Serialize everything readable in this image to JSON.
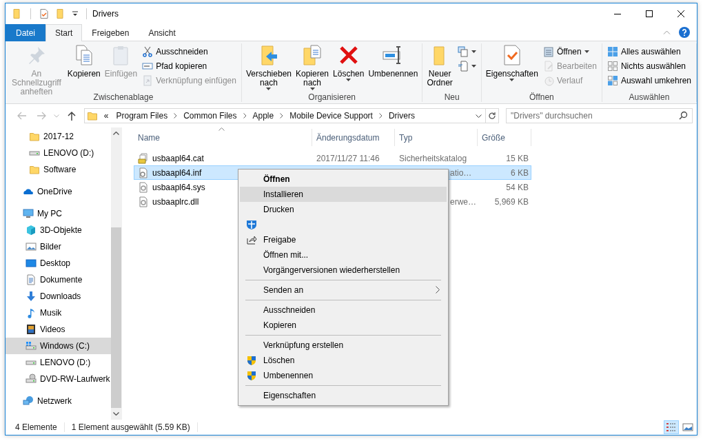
{
  "window": {
    "title": "Drivers"
  },
  "ribbon_tabs": [
    {
      "label": "Datei",
      "kind": "file",
      "selected": false
    },
    {
      "label": "Start",
      "kind": "tab",
      "selected": true
    },
    {
      "label": "Freigeben",
      "kind": "tab",
      "selected": false
    },
    {
      "label": "Ansicht",
      "kind": "tab",
      "selected": false
    }
  ],
  "ribbon_groups": [
    {
      "label": "Zwischenablage",
      "items": [
        {
          "kind": "pin",
          "label": "An Schnellzugriff\nanheften",
          "disabled": true,
          "dropdown": false
        },
        {
          "kind": "copy",
          "label": "Kopieren",
          "disabled": false,
          "dropdown": false
        },
        {
          "kind": "paste",
          "label": "Einfügen",
          "disabled": true,
          "dropdown": false
        },
        {
          "kind": "stack",
          "items": [
            {
              "kind": "cut",
              "label": "Ausschneiden",
              "disabled": false,
              "dropdown": false
            },
            {
              "kind": "copy-path",
              "label": "Pfad kopieren",
              "disabled": false,
              "dropdown": false
            },
            {
              "kind": "paste-shortcut",
              "label": "Verknüpfung einfügen",
              "disabled": true,
              "dropdown": false
            }
          ]
        }
      ]
    },
    {
      "label": "Organisieren",
      "items": [
        {
          "kind": "move-to",
          "label": "Verschieben\nnach",
          "disabled": false,
          "dropdown": true
        },
        {
          "kind": "copy-to",
          "label": "Kopieren\nnach",
          "disabled": false,
          "dropdown": true
        },
        {
          "kind": "delete",
          "label": "Löschen",
          "disabled": false,
          "dropdown": true
        },
        {
          "kind": "rename",
          "label": "Umbenennen",
          "disabled": false,
          "dropdown": false
        }
      ]
    },
    {
      "label": "Neu",
      "items": [
        {
          "kind": "new-folder",
          "label": "Neuer\nOrdner",
          "disabled": false,
          "dropdown": false
        },
        {
          "kind": "stack",
          "items": [
            {
              "kind": "new-item",
              "disabled": false,
              "dropdown": true
            },
            {
              "kind": "easy-access",
              "disabled": false,
              "dropdown": true
            }
          ]
        }
      ]
    },
    {
      "label": "Öffnen",
      "items": [
        {
          "kind": "properties",
          "label": "Eigenschaften",
          "disabled": false,
          "dropdown": true
        },
        {
          "kind": "stack",
          "items": [
            {
              "kind": "open",
              "label": "Öffnen",
              "disabled": false,
              "dropdown": true
            },
            {
              "kind": "edit",
              "label": "Bearbeiten",
              "disabled": true,
              "dropdown": false
            },
            {
              "kind": "history",
              "label": "Verlauf",
              "disabled": true,
              "dropdown": false
            }
          ]
        }
      ]
    },
    {
      "label": "Auswählen",
      "items": [
        {
          "kind": "stack",
          "items": [
            {
              "kind": "select-all",
              "label": "Alles auswählen",
              "disabled": false,
              "dropdown": false
            },
            {
              "kind": "select-none",
              "label": "Nichts auswählen",
              "disabled": false,
              "dropdown": false
            },
            {
              "kind": "invert-selection",
              "label": "Auswahl umkehren",
              "disabled": false,
              "dropdown": false
            }
          ]
        }
      ]
    }
  ],
  "address": {
    "overflow": "«",
    "segments": [
      "Program Files",
      "Common Files",
      "Apple",
      "Mobile Device Support",
      "Drivers"
    ]
  },
  "search": {
    "placeholder": "\"Drivers\" durchsuchen"
  },
  "quick_access_items": [
    {
      "label": "2017-12",
      "kind": "folder",
      "selected": false
    },
    {
      "label": "LENOVO (D:)",
      "kind": "drive",
      "selected": false
    },
    {
      "label": "Software",
      "kind": "folder",
      "selected": false
    }
  ],
  "tree": [
    {
      "label": "OneDrive",
      "kind": "onedrive",
      "selected": false
    },
    {
      "label": "My PC",
      "kind": "pc",
      "selected": false,
      "children": [
        {
          "label": "3D-Objekte",
          "kind": "cube",
          "selected": false
        },
        {
          "label": "Bilder",
          "kind": "pictures",
          "selected": false
        },
        {
          "label": "Desktop",
          "kind": "desktop",
          "selected": false
        },
        {
          "label": "Dokumente",
          "kind": "documents",
          "selected": false
        },
        {
          "label": "Downloads",
          "kind": "downloads",
          "selected": false
        },
        {
          "label": "Musik",
          "kind": "music",
          "selected": false
        },
        {
          "label": "Videos",
          "kind": "videos",
          "selected": false
        },
        {
          "label": "Windows (C:)",
          "kind": "system-drive",
          "selected": true
        },
        {
          "label": "LENOVO (D:)",
          "kind": "drive",
          "selected": false
        },
        {
          "label": "DVD-RW-Laufwerk",
          "kind": "dvd",
          "selected": false
        }
      ]
    },
    {
      "label": "Netzwerk",
      "kind": "network",
      "selected": false
    }
  ],
  "columns": [
    "Name",
    "Änderungsdatum",
    "Typ",
    "Größe"
  ],
  "files": [
    {
      "name": "usbaapl64.cat",
      "kind": "catalog",
      "date": "2017/11/27 11:46",
      "type": "Sicherheitskatalog",
      "size": "15 KB",
      "selected": false
    },
    {
      "name": "usbaapl64.inf",
      "kind": "setup",
      "type_visible_part": "atio…",
      "size": "6 KB",
      "selected": true
    },
    {
      "name": "usbaapl64.sys",
      "kind": "system",
      "size": "54 KB",
      "selected": false
    },
    {
      "name": "usbaaplrc.dll",
      "kind": "system",
      "type_visible_part": "erwe…",
      "size": "5,969 KB",
      "selected": false
    }
  ],
  "context_menu": [
    {
      "kind": "item",
      "label": "Öffnen",
      "bold": true,
      "highlighted": false
    },
    {
      "kind": "item",
      "label": "Installieren",
      "bold": false,
      "highlighted": true
    },
    {
      "kind": "item",
      "label": "Drucken",
      "bold": false,
      "highlighted": false
    },
    {
      "kind": "defender",
      "highlighted": false
    },
    {
      "kind": "share",
      "label": "Freigabe",
      "bold": false,
      "highlighted": false
    },
    {
      "kind": "item",
      "label": "Öffnen mit...",
      "bold": false,
      "highlighted": false
    },
    {
      "kind": "item",
      "label": "Vorgängerversionen wiederherstellen",
      "bold": false,
      "highlighted": false
    },
    {
      "kind": "separator"
    },
    {
      "kind": "item",
      "label": "Senden an",
      "bold": false,
      "highlighted": false,
      "submenu": true
    },
    {
      "kind": "separator"
    },
    {
      "kind": "item",
      "label": "Ausschneiden",
      "bold": false,
      "highlighted": false
    },
    {
      "kind": "item",
      "label": "Kopieren",
      "bold": false,
      "highlighted": false
    },
    {
      "kind": "separator"
    },
    {
      "kind": "item",
      "label": "Verknüpfung erstellen",
      "bold": false,
      "highlighted": false
    },
    {
      "kind": "admin",
      "label": "Löschen",
      "bold": false,
      "highlighted": false
    },
    {
      "kind": "admin",
      "label": "Umbenennen",
      "bold": false,
      "highlighted": false
    },
    {
      "kind": "separator"
    },
    {
      "kind": "item",
      "label": "Eigenschaften",
      "bold": false,
      "highlighted": false
    }
  ],
  "status_bar": {
    "item_count": "4 Elemente",
    "selection": "1 Element ausgewählt (5.59 KB)"
  },
  "view_buttons": [
    {
      "kind": "details",
      "selected": true
    },
    {
      "kind": "large-icons",
      "selected": false
    }
  ]
}
